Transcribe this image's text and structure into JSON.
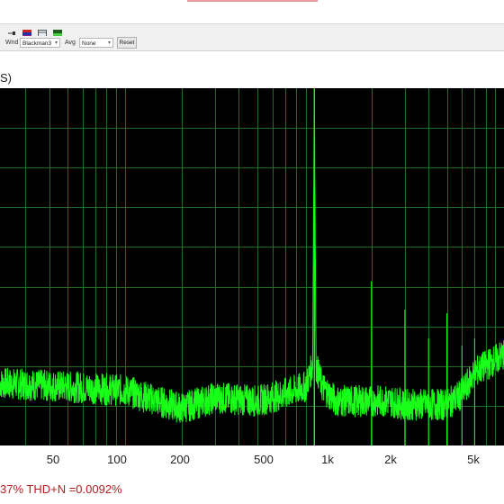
{
  "window": {
    "toolbar_icons": [
      "pen-icon",
      "color-palette-icon",
      "window-icon",
      "spectrum-icon"
    ]
  },
  "controls": {
    "wnd_label": "Wnd",
    "window_value": "Blackman3",
    "avg_label": "Avg",
    "avg_value": "None",
    "reset_label": "Reset"
  },
  "panel": {
    "title_fragment": "S)"
  },
  "colors": {
    "plot_background": "#000000",
    "grid": "#1f6b1f",
    "trace": "#19ff19",
    "status_text": "#b02020"
  },
  "chart_data": {
    "type": "line",
    "x_scale": "log",
    "xlim": [
      22,
      10000
    ],
    "x_ticks": [
      "50",
      "100",
      "200",
      "500",
      "1k",
      "2k",
      "5k"
    ],
    "x_tick_values": [
      50,
      100,
      200,
      500,
      1000,
      2000,
      5000
    ],
    "grid": true,
    "series": [
      {
        "x": [
          22,
          50,
          100,
          150,
          200,
          300,
          500,
          700,
          900,
          980,
          1000,
          1020,
          1100,
          1300,
          1600,
          2000,
          2500,
          3000,
          4000,
          5000,
          6000,
          7000,
          10000
        ],
        "relative_level": [
          0.17,
          0.16,
          0.15,
          0.12,
          0.1,
          0.13,
          0.12,
          0.14,
          0.16,
          0.22,
          1.0,
          0.22,
          0.16,
          0.12,
          0.12,
          0.12,
          0.12,
          0.11,
          0.11,
          0.11,
          0.14,
          0.2,
          0.25
        ]
      }
    ],
    "harmonics": [
      {
        "x": 2000,
        "relative_level": 0.46
      },
      {
        "x": 3000,
        "relative_level": 0.38
      },
      {
        "x": 4000,
        "relative_level": 0.3
      },
      {
        "x": 5000,
        "relative_level": 0.37
      },
      {
        "x": 6000,
        "relative_level": 0.28
      },
      {
        "x": 7000,
        "relative_level": 0.3
      }
    ]
  },
  "status": {
    "text": "37% THD+N =0.0092%"
  }
}
